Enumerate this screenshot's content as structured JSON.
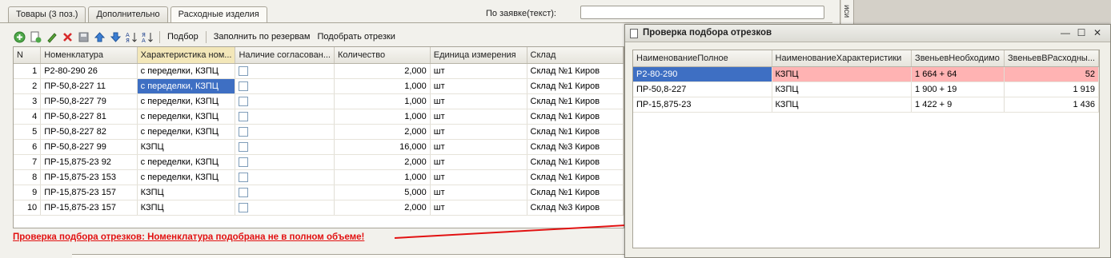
{
  "tabs": [
    "Товары (3 поз.)",
    "Дополнительно",
    "Расходные изделия"
  ],
  "order_label": "По заявке(текст):",
  "order_value": "",
  "toolbar": {
    "pick_label": "Подбор",
    "fill_label": "Заполнить по резервам",
    "select_label": "Подобрать отрезки"
  },
  "table": {
    "columns": [
      "N",
      "Номенклатура",
      "Характеристика ном...",
      "Наличие согласован...",
      "Количество",
      "Единица измерения",
      "Склад"
    ],
    "rows": [
      {
        "n": "1",
        "item": "Р2-80-290 26",
        "char": "с переделки, КЗПЦ",
        "qty": "2,000",
        "unit": "шт",
        "store": "Склад №1 Киров"
      },
      {
        "n": "2",
        "item": "ПР-50,8-227 11",
        "char": "с переделки, КЗПЦ",
        "qty": "1,000",
        "unit": "шт",
        "store": "Склад №1 Киров"
      },
      {
        "n": "3",
        "item": "ПР-50,8-227 79",
        "char": "с переделки, КЗПЦ",
        "qty": "1,000",
        "unit": "шт",
        "store": "Склад №1 Киров"
      },
      {
        "n": "4",
        "item": "ПР-50,8-227 81",
        "char": "с переделки, КЗПЦ",
        "qty": "1,000",
        "unit": "шт",
        "store": "Склад №1 Киров"
      },
      {
        "n": "5",
        "item": "ПР-50,8-227 82",
        "char": "с переделки, КЗПЦ",
        "qty": "2,000",
        "unit": "шт",
        "store": "Склад №1 Киров"
      },
      {
        "n": "6",
        "item": "ПР-50,8-227 99",
        "char": "КЗПЦ",
        "qty": "16,000",
        "unit": "шт",
        "store": "Склад №3 Киров"
      },
      {
        "n": "7",
        "item": "ПР-15,875-23 92",
        "char": "с переделки, КЗПЦ",
        "qty": "2,000",
        "unit": "шт",
        "store": "Склад №1 Киров"
      },
      {
        "n": "8",
        "item": "ПР-15,875-23 153",
        "char": "с переделки, КЗПЦ",
        "qty": "1,000",
        "unit": "шт",
        "store": "Склад №1 Киров"
      },
      {
        "n": "9",
        "item": "ПР-15,875-23 157",
        "char": "КЗПЦ",
        "qty": "5,000",
        "unit": "шт",
        "store": "Склад №1 Киров"
      },
      {
        "n": "10",
        "item": "ПР-15,875-23 157",
        "char": "КЗПЦ",
        "qty": "2,000",
        "unit": "шт",
        "store": "Склад №3 Киров"
      }
    ]
  },
  "status_message": "Проверка подбора отрезков: Номенклатура подобрана не в полном объеме!",
  "right_strip_text": "иси",
  "popup": {
    "title": "Проверка подбора отрезков",
    "columns": [
      "НаименованиеПолное",
      "НаименованиеХарактеристики",
      "ЗвеньевНеобходимо",
      "ЗвеньевВРасходны..."
    ],
    "rows": [
      {
        "name": "Р2-80-290",
        "char": "КЗПЦ",
        "needed": "1 664 + 64",
        "in_consumables": "52"
      },
      {
        "name": "ПР-50,8-227",
        "char": "КЗПЦ",
        "needed": "1 900 + 19",
        "in_consumables": "1 919"
      },
      {
        "name": "ПР-15,875-23",
        "char": "КЗПЦ",
        "needed": "1 422 + 9",
        "in_consumables": "1 436"
      }
    ]
  },
  "colors": {
    "error_text": "#e21111",
    "error_row": "#ffb3b3",
    "selection": "#3e6fc3"
  }
}
